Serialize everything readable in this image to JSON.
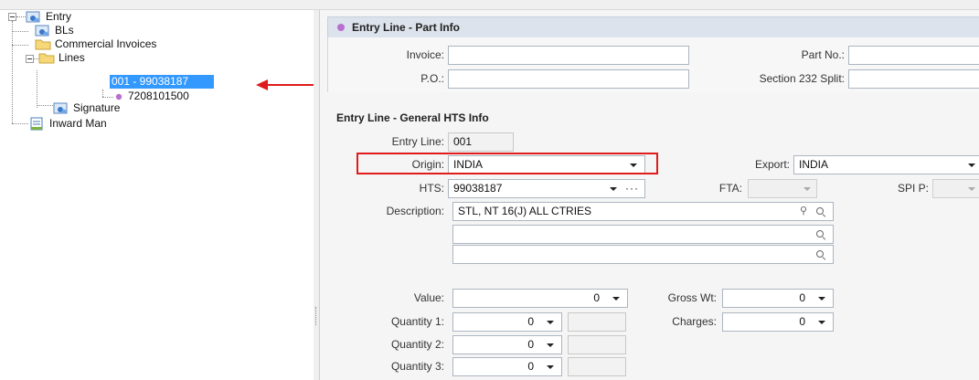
{
  "tree": {
    "root": {
      "label": "Entry",
      "icon": "entry-icon"
    },
    "items": [
      {
        "label": "BLs",
        "icon": "entry-icon"
      },
      {
        "label": "Commercial Invoices",
        "icon": "folder-icon"
      },
      {
        "label": "Lines",
        "icon": "folder-icon"
      },
      {
        "label": "001 - 99038187",
        "icon": "none"
      },
      {
        "label": "7208101500",
        "icon": "bullet-icon"
      },
      {
        "label": "Signature",
        "icon": "entry-icon"
      },
      {
        "label": "Inward Man",
        "icon": "document-icon"
      }
    ]
  },
  "part_info": {
    "title": "Entry Line - Part Info",
    "invoice_label": "Invoice:",
    "invoice_value": "",
    "part_no_label": "Part No.:",
    "part_no_value": "",
    "po_label": "P.O.:",
    "po_value": "",
    "section232_label": "Section 232 Split:",
    "section232_value": ""
  },
  "hts_info": {
    "title": "Entry Line - General HTS Info",
    "entry_line_label": "Entry Line:",
    "entry_line_value": "001",
    "origin_label": "Origin:",
    "origin_value": "INDIA",
    "export_label": "Export:",
    "export_value": "INDIA",
    "hts_label": "HTS:",
    "hts_value": "99038187",
    "fta_label": "FTA:",
    "spi_label": "SPI P:",
    "description_label": "Description:",
    "description_lines": [
      "STL, NT 16(J) ALL CTRIES",
      "",
      ""
    ],
    "value_label": "Value:",
    "value_value": "0",
    "gross_wt_label": "Gross Wt:",
    "gross_wt_value": "0",
    "charges_label": "Charges:",
    "charges_value": "0",
    "quantity1_label": "Quantity 1:",
    "quantity1_value": "0",
    "quantity2_label": "Quantity 2:",
    "quantity2_value": "0",
    "quantity3_label": "Quantity 3:",
    "quantity3_value": "0"
  },
  "colors": {
    "highlight": "#e01b1b",
    "selection": "#3399ff",
    "header_dot": "#b86fd0"
  }
}
